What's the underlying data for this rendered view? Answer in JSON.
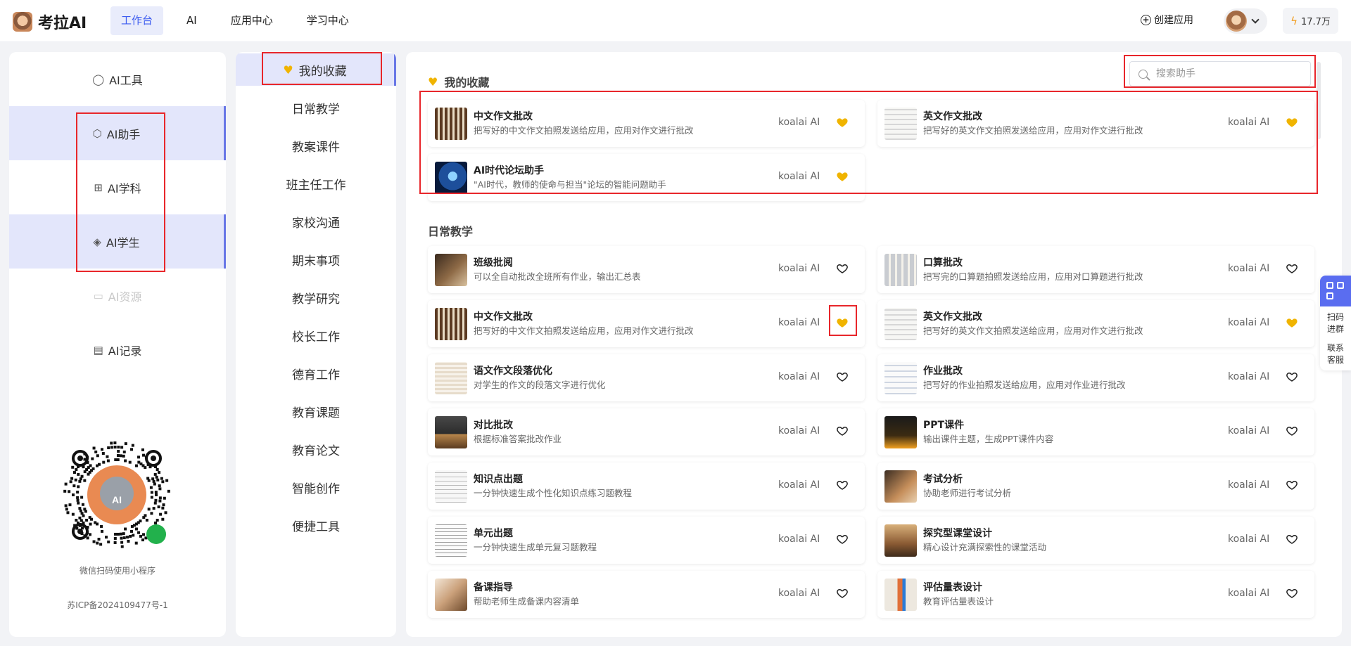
{
  "app": {
    "name": "考拉AI"
  },
  "nav": [
    "工作台",
    "AI",
    "应用中心",
    "学习中心"
  ],
  "header": {
    "create_label": "创建应用",
    "points": "17.7万"
  },
  "left_menu": [
    {
      "label": "AI工具",
      "icon": "chat-icon",
      "glyph": "◯"
    },
    {
      "label": "AI助手",
      "icon": "cube-icon",
      "glyph": "⬡"
    },
    {
      "label": "AI学科",
      "icon": "grid-icon",
      "glyph": "⊞"
    },
    {
      "label": "AI学生",
      "icon": "graduation-cap-icon",
      "glyph": "◈"
    },
    {
      "label": "AI资源",
      "icon": "folder-icon",
      "glyph": "▭"
    },
    {
      "label": "AI记录",
      "icon": "clipboard-icon",
      "glyph": "▤"
    }
  ],
  "qr_caption": "微信扫码使用小程序",
  "icp": "苏ICP备2024109477号-1",
  "categories": [
    "我的收藏",
    "日常教学",
    "教案课件",
    "班主任工作",
    "家校沟通",
    "期末事项",
    "教学研究",
    "校长工作",
    "德育工作",
    "教育课题",
    "教育论文",
    "智能创作",
    "便捷工具"
  ],
  "search": {
    "placeholder": "搜索助手"
  },
  "favorites_title": "我的收藏",
  "daily_title": "日常教学",
  "favorites": [
    {
      "title": "中文作文批改",
      "desc": "把写好的中文作文拍照发送给应用，应用对作文进行批改",
      "author": "koalai AI",
      "fav": true,
      "thumb": "grid-dark"
    },
    {
      "title": "英文作文批改",
      "desc": "把写好的英文作文拍照发送给应用，应用对作文进行批改",
      "author": "koalai AI",
      "fav": true,
      "thumb": "paper"
    },
    {
      "title": "AI时代论坛助手",
      "desc": "\"AI时代，教师的使命与担当\"论坛的智能问题助手",
      "author": "koalai AI",
      "fav": true,
      "thumb": "blue-tech"
    }
  ],
  "daily": [
    {
      "title": "班级批阅",
      "desc": "可以全自动批改全班所有作业，输出汇总表",
      "author": "koalai AI",
      "fav": false,
      "thumb": "desk"
    },
    {
      "title": "口算批改",
      "desc": "把写完的口算题拍照发送给应用，应用对口算题进行批改",
      "author": "koalai AI",
      "fav": false,
      "thumb": "tiles"
    },
    {
      "title": "中文作文批改",
      "desc": "把写好的中文作文拍照发送给应用，应用对作文进行批改",
      "author": "koalai AI",
      "fav": true,
      "thumb": "grid-dark"
    },
    {
      "title": "英文作文批改",
      "desc": "把写好的英文作文拍照发送给应用，应用对作文进行批改",
      "author": "koalai AI",
      "fav": true,
      "thumb": "paper"
    },
    {
      "title": "语文作文段落优化",
      "desc": "对学生的作文的段落文字进行优化",
      "author": "koalai AI",
      "fav": false,
      "thumb": "beige"
    },
    {
      "title": "作业批改",
      "desc": "把写好的作业拍照发送给应用，应用对作业进行批改",
      "author": "koalai AI",
      "fav": false,
      "thumb": "sheet"
    },
    {
      "title": "对比批改",
      "desc": "根据标准答案批改作业",
      "author": "koalai AI",
      "fav": false,
      "thumb": "books"
    },
    {
      "title": "PPT课件",
      "desc": "输出课件主题，生成PPT课件内容",
      "author": "koalai AI",
      "fav": false,
      "thumb": "screen"
    },
    {
      "title": "知识点出题",
      "desc": "一分钟快速生成个性化知识点练习题教程",
      "author": "koalai AI",
      "fav": false,
      "thumb": "table"
    },
    {
      "title": "考试分析",
      "desc": "协助老师进行考试分析",
      "author": "koalai AI",
      "fav": false,
      "thumb": "person"
    },
    {
      "title": "单元出题",
      "desc": "一分钟快速生成单元复习题教程",
      "author": "koalai AI",
      "fav": false,
      "thumb": "worksheet"
    },
    {
      "title": "探究型课堂设计",
      "desc": "精心设计充满探索性的课堂活动",
      "author": "koalai AI",
      "fav": false,
      "thumb": "classroom"
    },
    {
      "title": "备课指导",
      "desc": "帮助老师生成备课内容清单",
      "author": "koalai AI",
      "fav": false,
      "thumb": "writing"
    },
    {
      "title": "评估量表设计",
      "desc": "教育评估量表设计",
      "author": "koalai AI",
      "fav": false,
      "thumb": "pencil"
    }
  ],
  "floater": {
    "line1": "扫码",
    "line2": "进群",
    "line3": "联系",
    "line4": "客服"
  },
  "colors": {
    "accent": "#3d5cf0",
    "heart": "#f0b400",
    "highlight": "#e3e6fb",
    "annotation": "#e8262b"
  }
}
